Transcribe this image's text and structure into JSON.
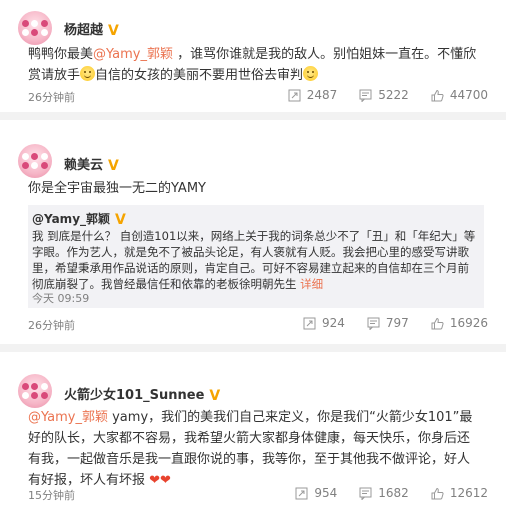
{
  "posts": [
    {
      "username": "杨超越",
      "badge": "V",
      "text_parts": [
        "鸭鸭你最美",
        "@Yamy_郭颖",
        " ，谁骂你谁就是我的敌人。别怕姐妹一直在。不懂欣赏请放手",
        "自信的女孩的美丽不要用世俗去审判"
      ],
      "time": "26分钟前",
      "reposts": "2487",
      "comments": "5222",
      "likes": "44700"
    },
    {
      "username": "赖美云",
      "badge": "V",
      "text": "你是全宇宙最独一无二的YAMY",
      "quote": {
        "username": "@Yamy_郭颖",
        "badge": "V",
        "text": "我 到底是什么？     自创造101以来，网络上关于我的词条总少不了「丑」和「年纪大」等字眼。作为艺人，就是免不了被品头论足，有人褒就有人贬。我会把心里的感受写讲歌里，希望秉承用作品说话的原则，肯定自己。可好不容易建立起来的自信却在三个月前彻底崩裂了。我曾经最信任和依靠的老板徐明朝先生",
        "more": "详细",
        "time": "今天 09:59"
      },
      "time": "26分钟前",
      "reposts": "924",
      "comments": "797",
      "likes": "16926"
    },
    {
      "username": "火箭少女101_Sunnee",
      "badge": "V",
      "text_parts": [
        "@Yamy_郭颖",
        " yamy，我们的美我们自己来定义，你是我们“火箭少女101”最好的队长，大家都不容易，我希望火箭大家都身体健康，每天快乐，你身后还有我，一起做音乐是我一直跟你说的事，我等你，至于其他我不做评论，好人有好报，坏人有坏报 "
      ],
      "hearts": "❤❤",
      "time": "15分钟前",
      "reposts": "954",
      "comments": "1682",
      "likes": "12612"
    }
  ],
  "colors": {
    "accent": "#eb7350",
    "badge": "#f5a400",
    "meta": "#808080"
  },
  "icons": {
    "repost": "repost-icon",
    "comment": "comment-icon",
    "like": "like-icon"
  }
}
